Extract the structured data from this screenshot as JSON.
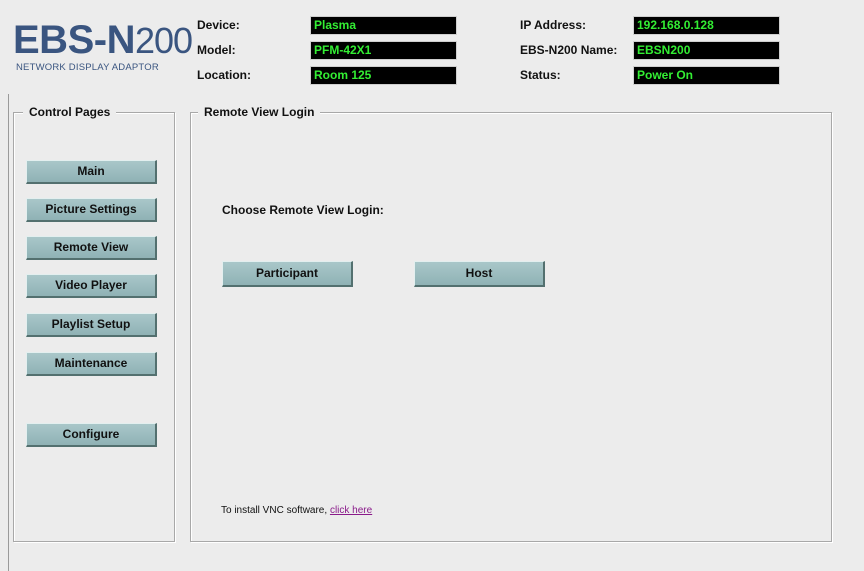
{
  "logo": {
    "brand_bold": "EBS-N",
    "brand_thin": "200",
    "tagline": "NETWORK DISPLAY ADAPTOR"
  },
  "header": {
    "device": {
      "label": "Device:",
      "value": "Plasma"
    },
    "model": {
      "label": "Model:",
      "value": "PFM-42X1"
    },
    "location": {
      "label": "Location:",
      "value": "Room 125"
    },
    "ip_address": {
      "label": "IP Address:",
      "value": "192.168.0.128"
    },
    "name": {
      "label": "EBS-N200 Name:",
      "value": "EBSN200"
    },
    "status": {
      "label": "Status:",
      "value": "Power On"
    }
  },
  "sidebar": {
    "title": "Control Pages",
    "items": [
      {
        "label": "Main"
      },
      {
        "label": "Picture Settings"
      },
      {
        "label": "Remote View"
      },
      {
        "label": "Video Player"
      },
      {
        "label": "Playlist Setup"
      },
      {
        "label": "Maintenance"
      },
      {
        "label": "Configure"
      }
    ]
  },
  "main": {
    "title": "Remote View Login",
    "prompt": "Choose Remote View Login:",
    "participant_label": "Participant",
    "host_label": "Host",
    "vnc_text": "To install VNC software, ",
    "vnc_link": "click here"
  },
  "colors": {
    "value_text": "#33ee33",
    "value_bg": "#000000",
    "button_face": "#9bbcbf",
    "logo_blue": "#3a5580",
    "link": "#8a1b8a"
  }
}
